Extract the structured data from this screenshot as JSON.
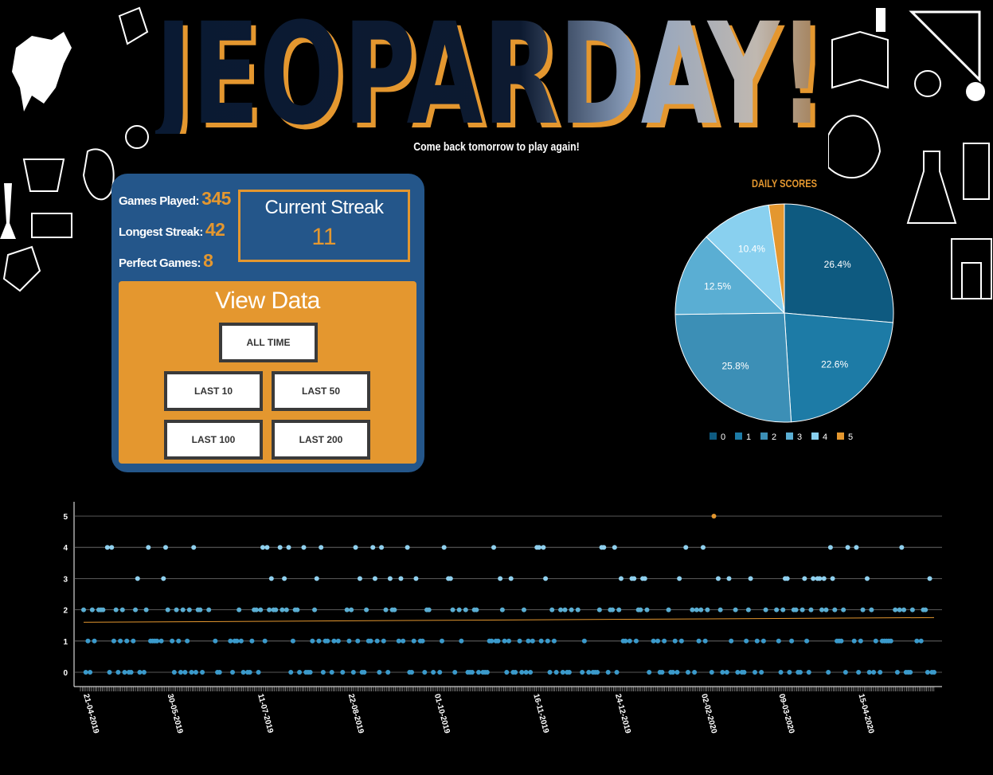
{
  "header": {
    "title": "JEOPARDAY!",
    "subtitle": "Come back tomorrow to play again!"
  },
  "stats": {
    "games_played_label": "Games Played:",
    "games_played": "345",
    "longest_streak_label": "Longest Streak:",
    "longest_streak": "42",
    "perfect_games_label": "Perfect Games:",
    "perfect_games": "8",
    "current_streak_label": "Current Streak",
    "current_streak": "11"
  },
  "view_data": {
    "heading": "View Data",
    "buttons": {
      "all_time": "ALL TIME",
      "last_10": "LAST 10",
      "last_50": "LAST 50",
      "last_100": "LAST 100",
      "last_200": "LAST 200"
    }
  },
  "colors": {
    "accent": "#e4972f",
    "panel": "#24568a",
    "score_colors": [
      "#0e5a80",
      "#1d7ba6",
      "#3c8fb6",
      "#5aaed3",
      "#89d0ef",
      "#e4972f"
    ]
  },
  "chart_data": [
    {
      "type": "pie",
      "title": "DAILY SCORES",
      "categories": [
        "0",
        "1",
        "2",
        "3",
        "4",
        "5"
      ],
      "values": [
        26.4,
        22.6,
        25.8,
        12.5,
        10.4,
        2.3
      ],
      "labels": [
        "26.4%",
        "22.6%",
        "25.8%",
        "12.5%",
        "10.4%",
        ""
      ],
      "legend": "bottom"
    },
    {
      "type": "scatter",
      "title": "",
      "xlabel": "",
      "ylabel": "",
      "ylim": [
        0,
        5
      ],
      "yticks": [
        "0",
        "1",
        "2",
        "3",
        "4",
        "5"
      ],
      "xtick_labels": [
        "21-04-2019",
        "30-05-2019",
        "11-07-2019",
        "22-08-2019",
        "01-10-2019",
        "16-11-2019",
        "24-12-2019",
        "02-02-2020",
        "09-03-2020",
        "15-04-2020"
      ],
      "x_date_range": [
        "2019-04-21",
        "2020-05-20"
      ],
      "trend_line": {
        "y_start": 1.6,
        "y_end": 1.75
      },
      "grid": "horizontal"
    }
  ]
}
